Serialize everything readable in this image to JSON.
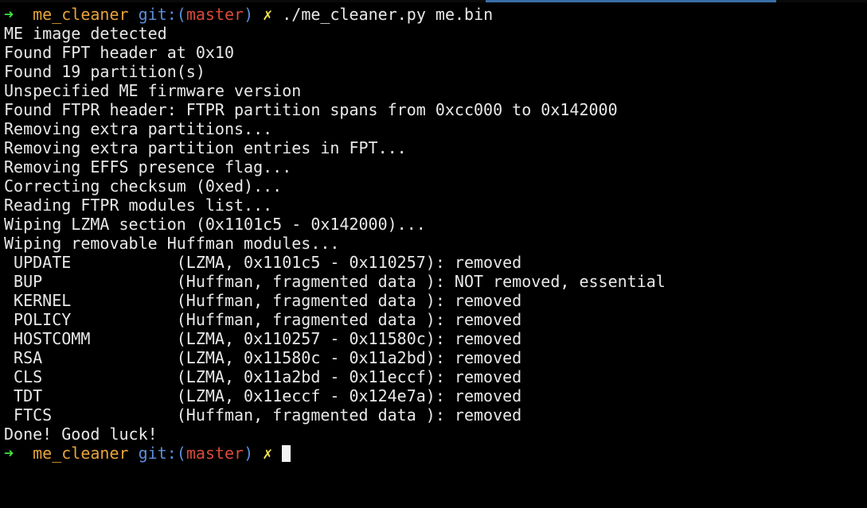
{
  "prompt1": {
    "arrow": "➜",
    "dir": "me_cleaner",
    "git_label": "git:(",
    "branch": "master",
    "git_close": ")",
    "dirty_mark": "✗",
    "command": "./me_cleaner.py me.bin"
  },
  "output": [
    "ME image detected",
    "Found FPT header at 0x10",
    "Found 19 partition(s)",
    "Unspecified ME firmware version",
    "Found FTPR header: FTPR partition spans from 0xcc000 to 0x142000",
    "Removing extra partitions...",
    "Removing extra partition entries in FPT...",
    "Removing EFFS presence flag...",
    "Correcting checksum (0xed)...",
    "Reading FTPR modules list...",
    "Wiping LZMA section (0x1101c5 - 0x142000)...",
    "Wiping removable Huffman modules...",
    " UPDATE           (LZMA, 0x1101c5 - 0x110257): removed",
    " BUP              (Huffman, fragmented data ): NOT removed, essential",
    " KERNEL           (Huffman, fragmented data ): removed",
    " POLICY           (Huffman, fragmented data ): removed",
    " HOSTCOMM         (LZMA, 0x110257 - 0x11580c): removed",
    " RSA              (LZMA, 0x11580c - 0x11a2bd): removed",
    " CLS              (LZMA, 0x11a2bd - 0x11eccf): removed",
    " TDT              (LZMA, 0x11eccf - 0x124e7a): removed",
    " FTCS             (Huffman, fragmented data ): removed",
    "Done! Good luck!"
  ],
  "prompt2": {
    "arrow": "➜",
    "dir": "me_cleaner",
    "git_label": "git:(",
    "branch": "master",
    "git_close": ")",
    "dirty_mark": "✗"
  },
  "colors": {
    "background": "#000000",
    "text": "#e8e8e8",
    "arrow": "#3ee33e",
    "dir": "#e8a33a",
    "git": "#5b8ed8",
    "branch": "#d84a3a",
    "dirty": "#f0e04a"
  }
}
